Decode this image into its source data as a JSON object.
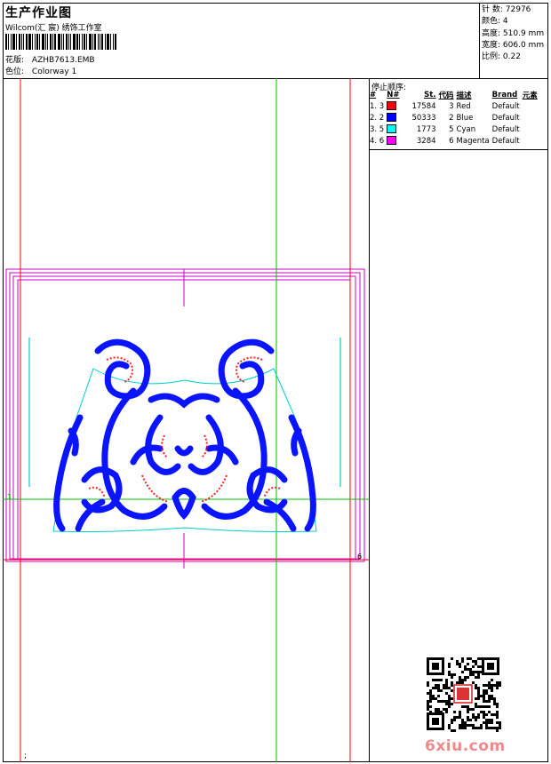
{
  "header": {
    "title": "生产作业图",
    "studio": "Wilcom(汇 宸) 绣饰工作室",
    "design_label": "花版:",
    "design_value": "AZHB7613.EMB",
    "colorway_label": "色位:",
    "colorway_value": "Colorway 1"
  },
  "stats": [
    {
      "label": "针 数:",
      "value": "72976"
    },
    {
      "label": "颜色:",
      "value": "4"
    },
    {
      "label": "高度:",
      "value": "510.9 mm"
    },
    {
      "label": "宽度:",
      "value": "606.0 mm"
    },
    {
      "label": "比例:",
      "value": "0.22"
    }
  ],
  "stop_sequence": {
    "title": "停止顺序:",
    "headers": [
      "#",
      "N#",
      "St.",
      "代码",
      "描述",
      "Brand",
      "元素"
    ],
    "rows": [
      {
        "idx": "1. 3",
        "color": "#ff0000",
        "st": "17584",
        "code": "3",
        "desc": "Red",
        "brand": "Default"
      },
      {
        "idx": "2. 2",
        "color": "#0000ff",
        "st": "50333",
        "code": "2",
        "desc": "Blue",
        "brand": "Default"
      },
      {
        "idx": "3. 5",
        "color": "#00ffff",
        "st": "1773",
        "code": "5",
        "desc": "Cyan",
        "brand": "Default"
      },
      {
        "idx": "4. 6",
        "color": "#ff00ff",
        "st": "3284",
        "code": "6",
        "desc": "Magenta",
        "brand": "Default"
      }
    ]
  },
  "canvas_markers": {
    "one": "1",
    "six": "6",
    "semi": ";"
  },
  "watermark": "6xiu.com",
  "colors": {
    "red_guide": "#ff0000",
    "green_guide": "#00c000",
    "magenta_frame": "#cc00cc",
    "cyan_outline": "#00cccc",
    "embroidery_blue": "#0a14ff",
    "embroidery_red": "#ff2020"
  }
}
